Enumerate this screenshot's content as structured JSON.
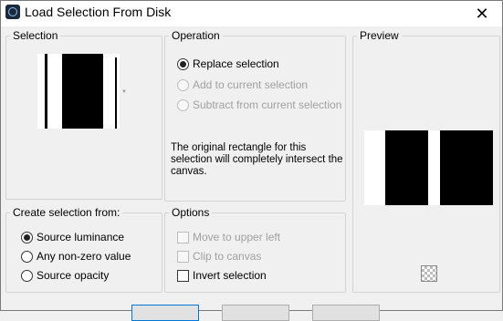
{
  "window": {
    "title": "Load Selection From Disk",
    "close_glyph": "✕",
    "app_icon": "app-icon"
  },
  "selection_group": {
    "label": "Selection"
  },
  "operation_group": {
    "label": "Operation",
    "options": [
      {
        "label": "Replace selection",
        "checked": true,
        "enabled": true
      },
      {
        "label": "Add to current selection",
        "checked": false,
        "enabled": false
      },
      {
        "label": "Subtract from current selection",
        "checked": false,
        "enabled": false
      }
    ],
    "description": "The original rectangle for this selection will completely intersect the canvas."
  },
  "preview_group": {
    "label": "Preview",
    "transparency_icon": "checkerboard-icon"
  },
  "create_group": {
    "label": "Create selection from:",
    "options": [
      {
        "label": "Source luminance",
        "checked": true
      },
      {
        "label": "Any non-zero value",
        "checked": false
      },
      {
        "label": "Source opacity",
        "checked": false
      }
    ]
  },
  "options_group": {
    "label": "Options",
    "items": [
      {
        "label": "Move to upper left",
        "checked": false,
        "enabled": false
      },
      {
        "label": "Clip to canvas",
        "checked": false,
        "enabled": false
      },
      {
        "label": "Invert selection",
        "checked": false,
        "enabled": true
      }
    ]
  },
  "colors": {
    "title_bg": "#ffffff",
    "dialog_bg": "#f0f0f0",
    "group_border": "#d4d4d4",
    "disabled_text": "#a0a0a0",
    "default_button_border": "#0078d7"
  }
}
